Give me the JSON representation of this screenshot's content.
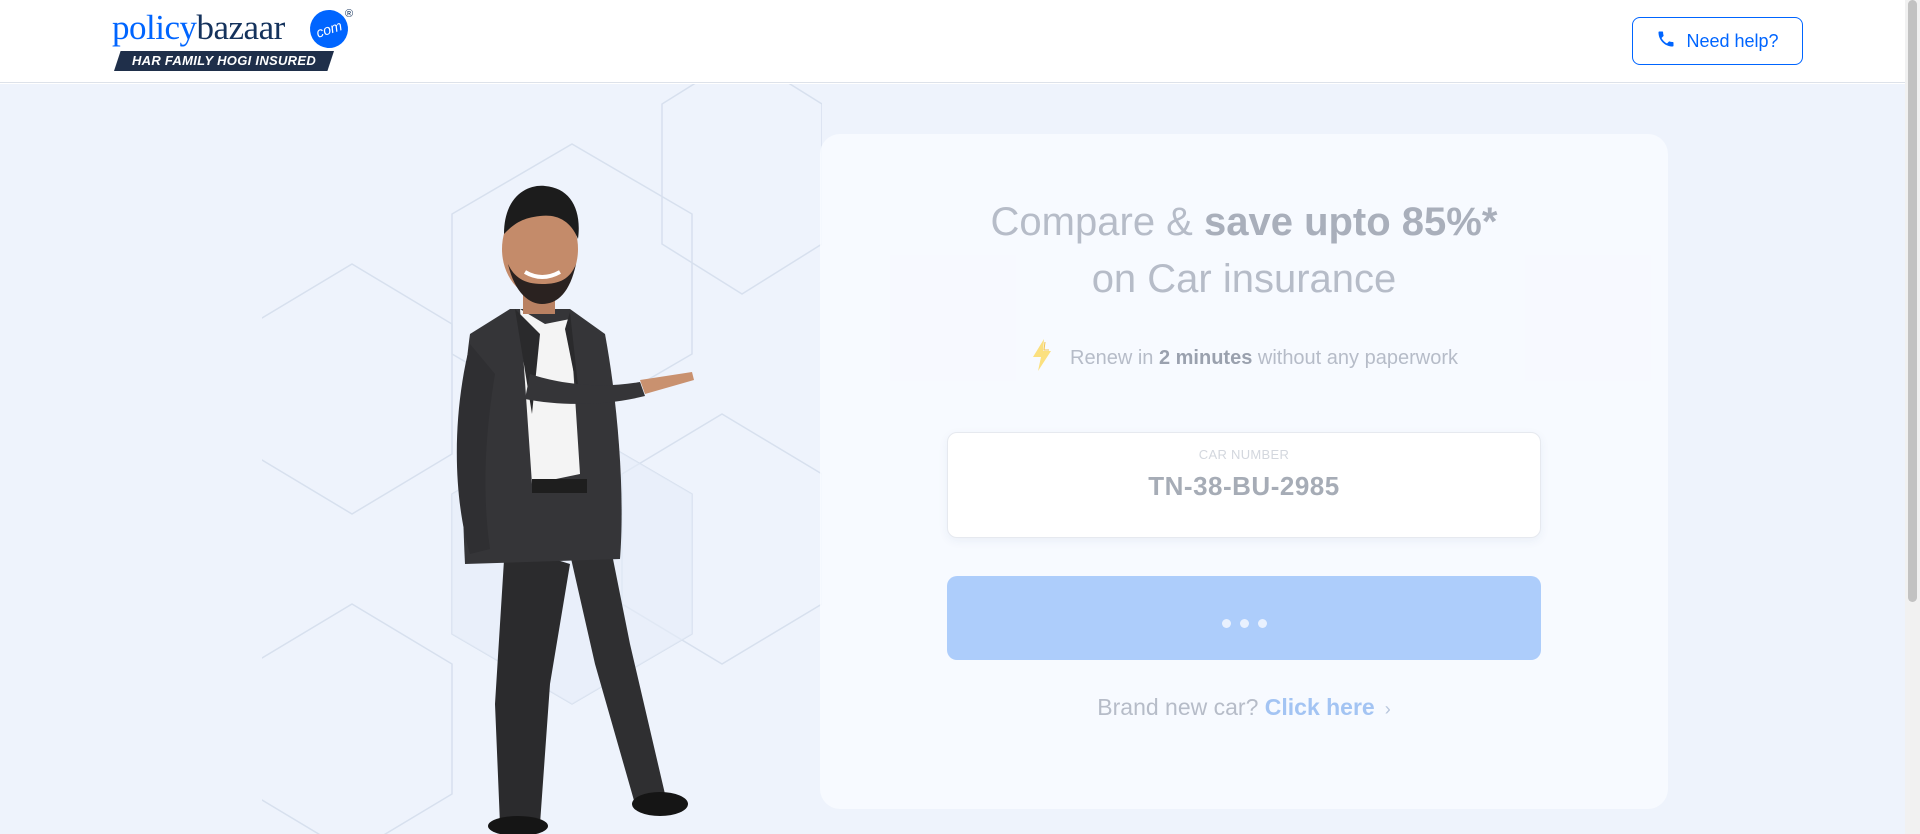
{
  "header": {
    "logo": {
      "word_policy": "policy",
      "word_bazaar": "bazaar",
      "badge": "com",
      "registered": "®",
      "tagline": "HAR FAMILY HOGI INSURED"
    },
    "help_button_label": "Need help?",
    "help_icon": "phone-icon"
  },
  "hero": {
    "headline_pre": "Compare & ",
    "headline_bold": "save upto 85%*",
    "headline_line2": "on Car insurance",
    "renew_pre": "Renew in ",
    "renew_bold": "2 minutes",
    "renew_post": " without any paperwork",
    "renew_icon": "lightning-bolt-icon",
    "car_field": {
      "label": "CAR NUMBER",
      "value": "TN-38-BU-2985"
    },
    "submit_state": "loading",
    "new_car_text": "Brand new car? ",
    "new_car_link": "Click here",
    "new_car_chevron": "›"
  },
  "colors": {
    "brand_blue": "#0065ff",
    "navy": "#14325c",
    "hero_bg": "#eef3fc",
    "button_disabled": "#adcdfb"
  }
}
